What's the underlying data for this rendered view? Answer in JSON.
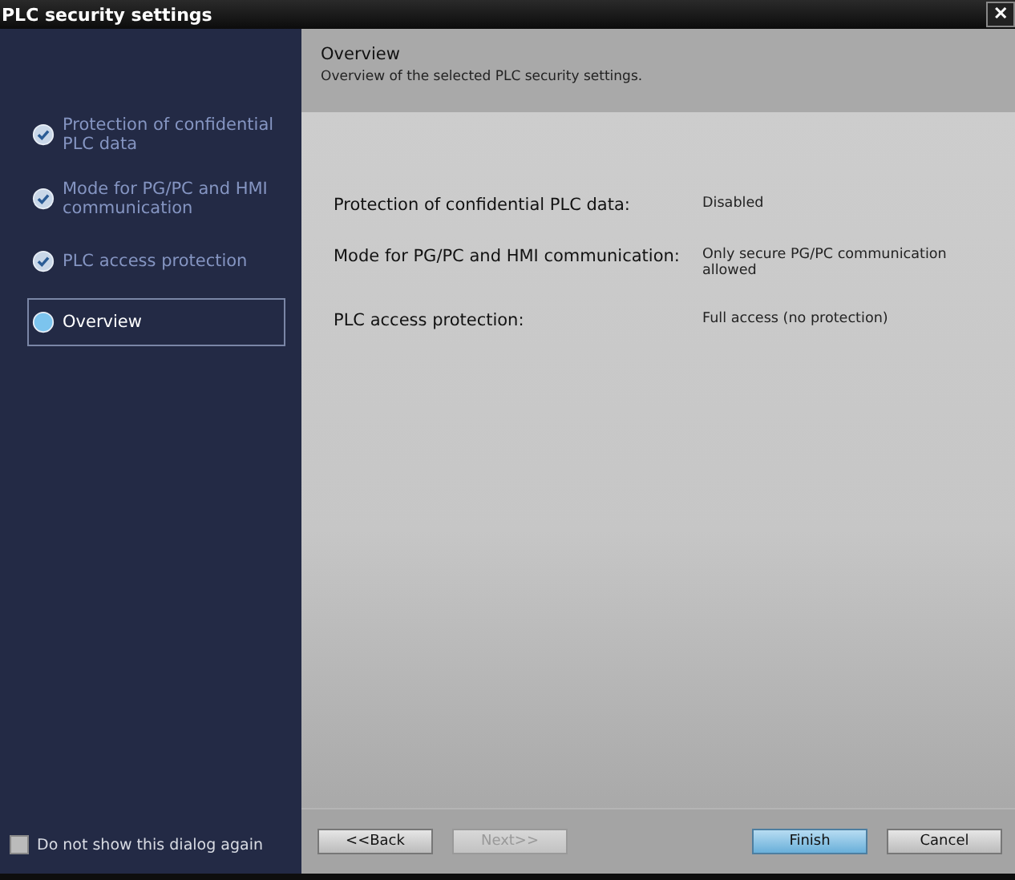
{
  "window": {
    "title": "PLC security settings",
    "close": "✕"
  },
  "steps": [
    {
      "label": "Protection of confidential PLC data",
      "completed": true,
      "selected": false
    },
    {
      "label": "Mode for PG/PC and HMI communication",
      "completed": true,
      "selected": false
    },
    {
      "label": "PLC access protection",
      "completed": true,
      "selected": false
    },
    {
      "label": "Overview",
      "completed": false,
      "selected": true
    }
  ],
  "header": {
    "title": "Overview",
    "subtitle": "Overview of the selected PLC security settings."
  },
  "summary": [
    {
      "label": "Protection of confidential PLC data:",
      "value": "Disabled"
    },
    {
      "label": "Mode for PG/PC and HMI communication:",
      "value": "Only secure PG/PC communication allowed"
    },
    {
      "label": "PLC access protection:",
      "value": "Full access (no protection)"
    }
  ],
  "dont_show": {
    "label": "Do not show this dialog again",
    "checked": false
  },
  "buttons": [
    {
      "label": "<<Back",
      "disabled": false,
      "primary": false
    },
    {
      "label": "Next>>",
      "disabled": true,
      "primary": false
    },
    {
      "label": "Finish",
      "disabled": false,
      "primary": true
    },
    {
      "label": "Cancel",
      "disabled": false,
      "primary": false
    }
  ]
}
